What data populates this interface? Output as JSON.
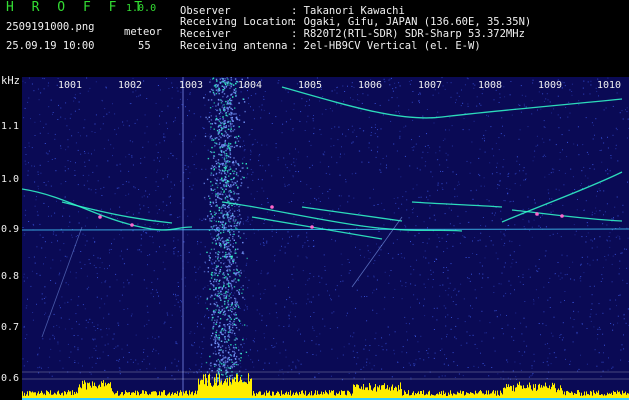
{
  "header": {
    "brand": "H R O F F T",
    "version": "1.0.0",
    "filename": "2509191000.png",
    "datetime": "25.09.19 10:00",
    "meteor_label": "meteor",
    "meteor_count": "55"
  },
  "info": [
    {
      "label": "Observer",
      "value": ": Takanori Kawachi"
    },
    {
      "label": "Receiving Location",
      "value": ": Ogaki, Gifu, JAPAN (136.60E, 35.35N)"
    },
    {
      "label": "Receiver",
      "value": ": R820T2(RTL-SDR) SDR-Sharp 53.372MHz"
    },
    {
      "label": "Receiving antenna",
      "value": ": 2el-HB9CV Vertical (el. E-W)"
    }
  ],
  "chart_data": {
    "type": "heatmap",
    "ylabel": "kHz",
    "yticks": [
      "1.1",
      "1.0",
      "0.9",
      "0.8",
      "0.7",
      "0.6"
    ],
    "xticks": [
      "1001",
      "1002",
      "1003",
      "1004",
      "1005",
      "1006",
      "1007",
      "1008",
      "1009",
      "1010"
    ],
    "colors": {
      "background": "#0a0a55",
      "noise": "#4466ff",
      "signal": "#33ffcc",
      "strong": "#ff66cc",
      "histogram": "#ffee00"
    }
  }
}
